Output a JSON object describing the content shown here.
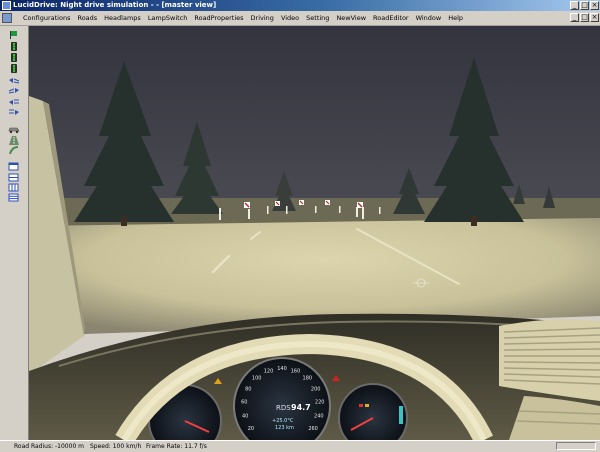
{
  "window": {
    "title": "LucidDrive: Night drive simulation - - [master view]",
    "minimize_glyph": "_",
    "maximize_glyph": "□",
    "close_glyph": "×"
  },
  "menu": {
    "items": [
      "Configurations",
      "Roads",
      "Headlamps",
      "LampSwitch",
      "RoadProperties",
      "Driving",
      "Video",
      "Setting",
      "NewView",
      "RoadEditor",
      "Window",
      "Help"
    ]
  },
  "toolbar": {
    "icons": [
      "flag-icon",
      "traffic-light-icon",
      "traffic-light-icon",
      "traffic-light-icon",
      "low-beam-left-icon",
      "low-beam-right-icon",
      "high-beam-left-icon",
      "high-beam-right-icon",
      "car-icon",
      "road-icon",
      "curve-icon",
      "window-icon",
      "window-split-icon",
      "columns-icon",
      "rows-icon"
    ]
  },
  "instrument_cluster": {
    "speedo_label": "RDS",
    "speedo_value": "94.7",
    "temp_readout": "+25.0°C",
    "km_readout": "123 km",
    "ticks": [
      "20",
      "40",
      "60",
      "80",
      "100",
      "120",
      "140",
      "160",
      "180",
      "200",
      "220",
      "240",
      "260"
    ]
  },
  "status": {
    "road_radius": "Road Radius: -10000 m",
    "speed": "Speed: 100 km/h",
    "frame_rate": "Frame Rate: 11.7 f/s"
  },
  "colors": {
    "title_start": "#0a246a",
    "title_end": "#a6caf0",
    "sky": "#3c3c48",
    "road_lit": "#d8d1a8",
    "dashboard": "#4a4838",
    "wheel": "#e0d9b4"
  }
}
